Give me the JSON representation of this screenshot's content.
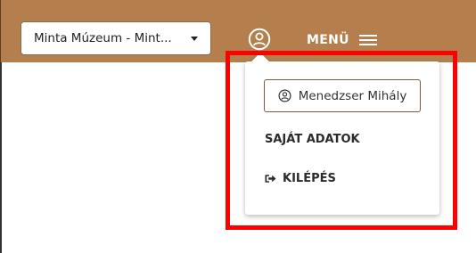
{
  "header": {
    "museum_select": {
      "value": "Minta Múzeum - Mint..."
    },
    "user_icon": "user-circle-icon",
    "menu_label": "MENÜ"
  },
  "user_dropdown": {
    "user_name": "Menedzser Mihály",
    "items": [
      {
        "label": "SAJÁT ADATOK"
      },
      {
        "label": "KILÉPÉS",
        "icon": "sign-out-icon"
      }
    ]
  },
  "colors": {
    "topbar": "#b57f4d",
    "highlight": "#ff0000",
    "chip_border": "#7a5a3e"
  }
}
